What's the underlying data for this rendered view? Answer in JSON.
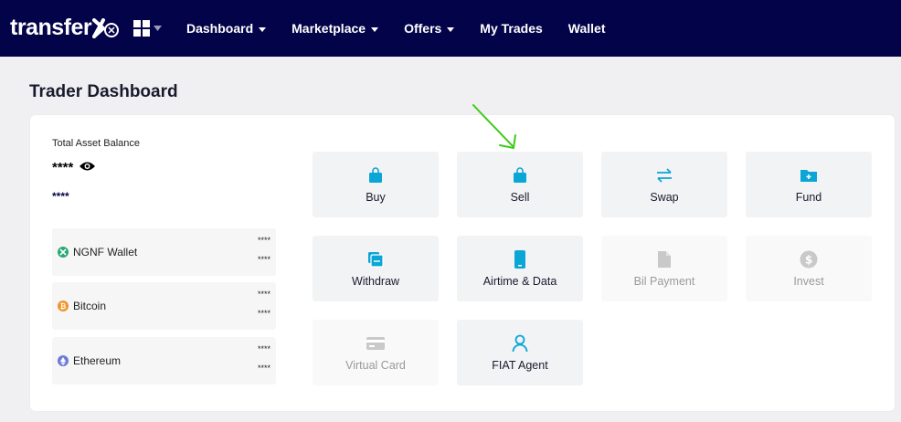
{
  "brand": {
    "name": "transfer"
  },
  "nav": {
    "items": [
      {
        "label": "Dashboard",
        "dropdown": true
      },
      {
        "label": "Marketplace",
        "dropdown": true
      },
      {
        "label": "Offers",
        "dropdown": true
      },
      {
        "label": "My Trades",
        "dropdown": false
      },
      {
        "label": "Wallet",
        "dropdown": false
      }
    ]
  },
  "page": {
    "title": "Trader Dashboard"
  },
  "balance": {
    "label": "Total Asset Balance",
    "main_value": "****",
    "sub_value": "****"
  },
  "wallets": [
    {
      "name": "NGNF Wallet",
      "value1": "****",
      "value2": "****",
      "coin_color": "#2aa876"
    },
    {
      "name": "Bitcoin",
      "value1": "****",
      "value2": "****",
      "coin_color": "#f0952a"
    },
    {
      "name": "Ethereum",
      "value1": "****",
      "value2": "****",
      "coin_color": "#6b7bd8"
    }
  ],
  "actions": [
    {
      "label": "Buy",
      "icon": "shopping-bag-icon",
      "enabled": true
    },
    {
      "label": "Sell",
      "icon": "shopping-bag-icon",
      "enabled": true
    },
    {
      "label": "Swap",
      "icon": "swap-arrows-icon",
      "enabled": true
    },
    {
      "label": "Fund",
      "icon": "folder-plus-icon",
      "enabled": true
    },
    {
      "label": "Withdraw",
      "icon": "cards-icon",
      "enabled": true
    },
    {
      "label": "Airtime & Data",
      "icon": "phone-icon",
      "enabled": true
    },
    {
      "label": "Bil Payment",
      "icon": "document-icon",
      "enabled": false
    },
    {
      "label": "Invest",
      "icon": "dollar-coin-icon",
      "enabled": false
    },
    {
      "label": "Virtual Card",
      "icon": "credit-card-icon",
      "enabled": false
    },
    {
      "label": "FIAT Agent",
      "icon": "user-icon",
      "enabled": true
    }
  ],
  "colors": {
    "navbar": "#03034a",
    "accent": "#0ba5d6",
    "disabled_icon": "#c9c9c9",
    "annotation_arrow": "#3ecb1a"
  }
}
